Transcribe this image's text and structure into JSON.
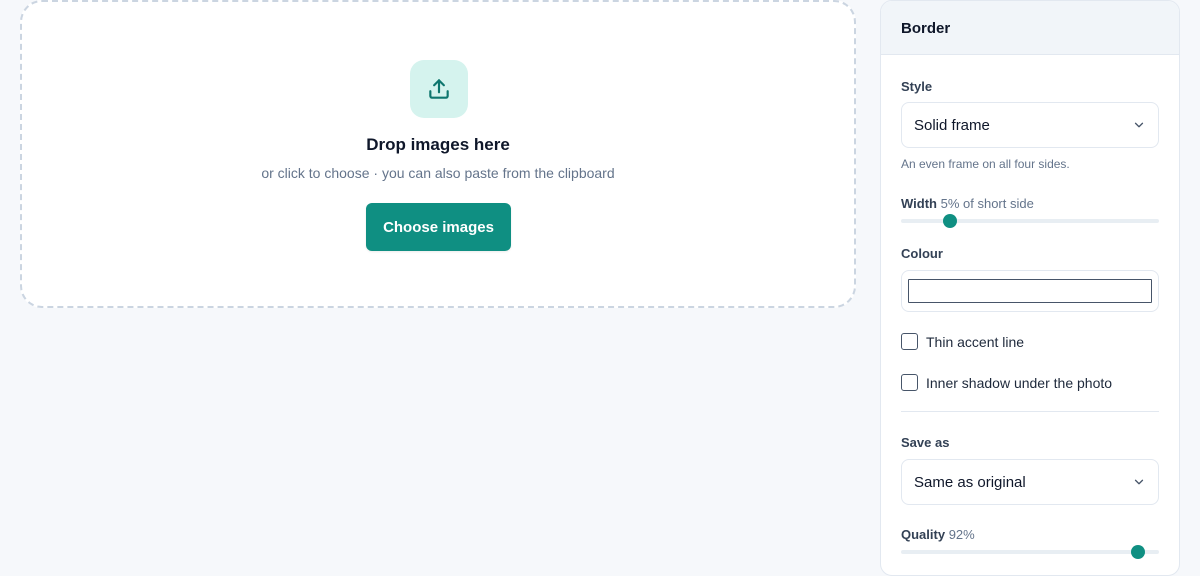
{
  "dropzone": {
    "title": "Drop images here",
    "subtitle": "or click to choose · you can also paste from the clipboard",
    "button_label": "Choose images",
    "icon": "upload-icon"
  },
  "panel": {
    "title": "Border",
    "style": {
      "label": "Style",
      "value": "Solid frame",
      "hint": "An even frame on all four sides."
    },
    "width": {
      "label": "Width",
      "value_text": "5% of short side",
      "level": 0.19
    },
    "colour": {
      "label": "Colour",
      "value": "#ffffff"
    },
    "options": [
      {
        "label": "Thin accent line",
        "checked": false
      },
      {
        "label": "Inner shadow under the photo",
        "checked": false
      }
    ],
    "save_as": {
      "label": "Save as",
      "value": "Same as original"
    },
    "quality": {
      "label": "Quality",
      "value_text": "92%",
      "level": 0.92
    }
  },
  "colors": {
    "accent": "#0f8f82",
    "accent_soft": "#d5f3ee",
    "background": "#f6f8fb"
  }
}
